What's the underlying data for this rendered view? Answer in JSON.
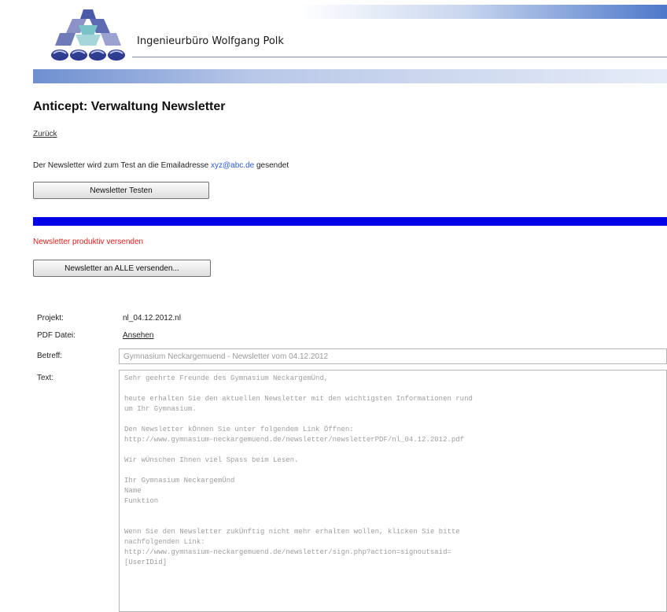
{
  "header": {
    "company_name": "Ingenieurbüro Wolfgang Polk"
  },
  "page": {
    "title": "Anticept: Verwaltung Newsletter",
    "back_link": "Zurück"
  },
  "test_section": {
    "info_prefix": "Der Newsletter wird zum Test an die Emailadresse",
    "email": "xyz@abc.de",
    "info_suffix": "gesendet",
    "test_button": "Newsletter Testen"
  },
  "send_section": {
    "warning": "Newsletter produktiv versenden",
    "send_button": "Newsletter an ALLE versenden..."
  },
  "form": {
    "project_label": "Projekt:",
    "project_value": "nl_04.12.2012.nl",
    "pdf_label": "PDF Datei:",
    "pdf_link": "Ansehen",
    "subject_label": "Betreff:",
    "subject_value": "Gymnasium Neckargemuend - Newsletter vom 04.12.2012",
    "text_label": "Text:",
    "text_value": "Sehr geehrte Freunde des Gymnasium NeckargemÜnd,\n\nheute erhalten Sie den aktuellen Newsletter mit den wichtigsten Informationen rund\num Ihr Gymnasium.\n\nDen Newsletter kÖnnen Sie unter folgendem Link Öffnen:\nhttp://www.gymnasium-neckargemuend.de/newsletter/newsletterPDF/nl_04.12.2012.pdf\n\nWir wÜnschen Ihnen viel Spass beim Lesen.\n\nIhr Gymnasium NeckargemÜnd\nName\nFunktion\n\n\nWenn Sie den Newsletter zukÜnftig nicht mehr erhalten wollen, klicken Sie bitte\nnachfolgenden Link:\nhttp://www.gymnasium-neckargemuend.de/newsletter/sign.php?action=signoutsaid=\n[UserIDid]"
  },
  "colors": {
    "accent_blue_bar": "#0000e6",
    "warning_red": "#e01b1b",
    "link_blue": "#2a5bd7"
  }
}
